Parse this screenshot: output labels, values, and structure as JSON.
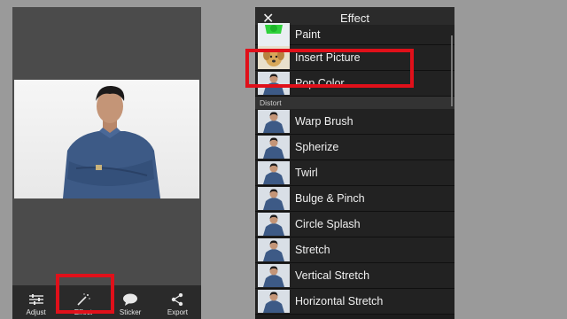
{
  "left_phone": {
    "toolbar": [
      {
        "label": "Adjust",
        "icon": "sliders-icon"
      },
      {
        "label": "Effect",
        "icon": "magic-wand-icon"
      },
      {
        "label": "Sticker",
        "icon": "speech-bubble-icon"
      },
      {
        "label": "Export",
        "icon": "share-icon"
      }
    ]
  },
  "effect_panel": {
    "title": "Effect",
    "close_icon": "close-icon",
    "items_top": [
      {
        "label": "Paint",
        "thumb": "paint-thumb"
      },
      {
        "label": "Insert Picture",
        "thumb": "dog-thumb"
      },
      {
        "label": "Pop Color",
        "thumb": "person-thumb"
      }
    ],
    "section_label": "Distort",
    "items_distort": [
      {
        "label": "Warp Brush"
      },
      {
        "label": "Spherize"
      },
      {
        "label": "Twirl"
      },
      {
        "label": "Bulge & Pinch"
      },
      {
        "label": "Circle Splash"
      },
      {
        "label": "Stretch"
      },
      {
        "label": "Vertical Stretch"
      },
      {
        "label": "Horizontal Stretch"
      }
    ]
  },
  "colors": {
    "highlight": "#e0101a",
    "shirt": "#3d5a86"
  }
}
